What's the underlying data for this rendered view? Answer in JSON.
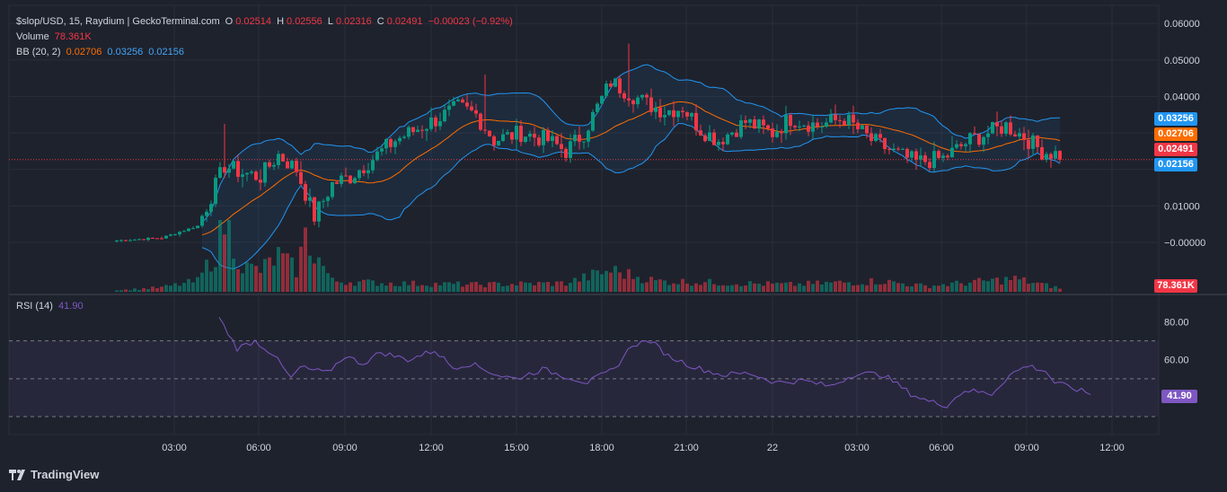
{
  "legend": {
    "symbol": "$slop/USD, 15, Raydium | GeckoTerminal.com",
    "o_label": "O",
    "o_value": "0.02514",
    "h_label": "H",
    "h_value": "0.02556",
    "l_label": "L",
    "l_value": "0.02316",
    "c_label": "C",
    "c_value": "0.02491",
    "change": "−0.00023 (−0.92%)",
    "volume_label": "Volume",
    "volume_value": "78.361K",
    "bb_label": "BB (20, 2)",
    "bb_mid": "0.02706",
    "bb_upper": "0.03256",
    "bb_lower": "0.02156",
    "rsi_label": "RSI (14)",
    "rsi_value": "41.90"
  },
  "price_axis": {
    "ticks": [
      "0.06000",
      "0.05000",
      "0.04000",
      "0.01000",
      "−0.00000"
    ],
    "tags": {
      "upper": "0.03256",
      "mid": "0.02706",
      "close": "0.02491",
      "lower": "0.02156",
      "volume": "78.361K"
    }
  },
  "rsi_axis": {
    "ticks": [
      "80.00",
      "60.00"
    ],
    "tag": "41.90"
  },
  "time_axis": {
    "ticks": [
      "03:00",
      "06:00",
      "09:00",
      "12:00",
      "15:00",
      "18:00",
      "21:00",
      "22",
      "03:00",
      "06:00",
      "09:00",
      "12:00"
    ]
  },
  "footer": {
    "brand": "TradingView"
  },
  "colors": {
    "up": "#089981",
    "down": "#f23645",
    "bb_mid": "#ff6d00",
    "bb_band": "#2196f3",
    "rsi": "#7e57c2",
    "background": "#1e222d",
    "grid": "#2a2e39"
  },
  "chart_data": [
    {
      "type": "candlestick",
      "pair": "$slop/USD",
      "interval": "15",
      "ylim": [
        -0.002,
        0.062
      ],
      "close_anchors": [
        [
          0,
          0.0005
        ],
        [
          10,
          0.0012
        ],
        [
          18,
          0.0045
        ],
        [
          24,
          0.021
        ],
        [
          28,
          0.019
        ],
        [
          32,
          0.018
        ],
        [
          36,
          0.024
        ],
        [
          40,
          0.02
        ],
        [
          44,
          0.007
        ],
        [
          48,
          0.016
        ],
        [
          52,
          0.018
        ],
        [
          56,
          0.022
        ],
        [
          62,
          0.028
        ],
        [
          70,
          0.033
        ],
        [
          76,
          0.037
        ],
        [
          80,
          0.035
        ],
        [
          84,
          0.028
        ],
        [
          90,
          0.03
        ],
        [
          96,
          0.028
        ],
        [
          100,
          0.025
        ],
        [
          104,
          0.03
        ],
        [
          110,
          0.044
        ],
        [
          114,
          0.041
        ],
        [
          118,
          0.038
        ],
        [
          122,
          0.036
        ],
        [
          126,
          0.037
        ],
        [
          130,
          0.031
        ],
        [
          134,
          0.028
        ],
        [
          140,
          0.033
        ],
        [
          146,
          0.03
        ],
        [
          150,
          0.034
        ],
        [
          156,
          0.032
        ],
        [
          162,
          0.034
        ],
        [
          168,
          0.028
        ],
        [
          174,
          0.024
        ],
        [
          178,
          0.022
        ],
        [
          184,
          0.023
        ],
        [
          190,
          0.028
        ],
        [
          194,
          0.03
        ],
        [
          198,
          0.032
        ],
        [
          202,
          0.029
        ],
        [
          206,
          0.025
        ],
        [
          210,
          0.024
        ]
      ]
    },
    {
      "type": "bar",
      "series": [
        {
          "name": "Volume"
        }
      ],
      "latest": "78.361K",
      "relative_anchors": [
        [
          0,
          0.02
        ],
        [
          10,
          0.06
        ],
        [
          18,
          0.15
        ],
        [
          22,
          0.55
        ],
        [
          24,
          1.0
        ],
        [
          28,
          0.35
        ],
        [
          32,
          0.3
        ],
        [
          36,
          0.5
        ],
        [
          40,
          0.3
        ],
        [
          42,
          0.75
        ],
        [
          44,
          0.55
        ],
        [
          48,
          0.15
        ],
        [
          60,
          0.12
        ],
        [
          80,
          0.1
        ],
        [
          100,
          0.12
        ],
        [
          110,
          0.3
        ],
        [
          120,
          0.15
        ],
        [
          150,
          0.1
        ],
        [
          170,
          0.15
        ],
        [
          180,
          0.08
        ],
        [
          200,
          0.18
        ],
        [
          210,
          0.05
        ]
      ]
    },
    {
      "type": "line",
      "series": [
        {
          "name": "RSI (14)"
        }
      ],
      "ylim": [
        30,
        85
      ],
      "y_ticks": [
        80,
        60
      ],
      "bands": [
        70,
        50,
        30
      ],
      "latest": 41.9,
      "anchors": [
        [
          0,
          82
        ],
        [
          4,
          66
        ],
        [
          8,
          70
        ],
        [
          12,
          63
        ],
        [
          16,
          50
        ],
        [
          18,
          56
        ],
        [
          24,
          53
        ],
        [
          28,
          62
        ],
        [
          32,
          58
        ],
        [
          36,
          64
        ],
        [
          42,
          60
        ],
        [
          48,
          65
        ],
        [
          52,
          56
        ],
        [
          56,
          58
        ],
        [
          62,
          52
        ],
        [
          66,
          50
        ],
        [
          72,
          55
        ],
        [
          76,
          52
        ],
        [
          82,
          48
        ],
        [
          88,
          55
        ],
        [
          92,
          68
        ],
        [
          96,
          70
        ],
        [
          100,
          62
        ],
        [
          106,
          56
        ],
        [
          112,
          52
        ],
        [
          118,
          53
        ],
        [
          124,
          48
        ],
        [
          130,
          49
        ],
        [
          136,
          46
        ],
        [
          142,
          53
        ],
        [
          148,
          52
        ],
        [
          154,
          42
        ],
        [
          158,
          38
        ],
        [
          162,
          36
        ],
        [
          166,
          44
        ],
        [
          172,
          42
        ],
        [
          176,
          52
        ],
        [
          180,
          57
        ],
        [
          184,
          54
        ],
        [
          186,
          48
        ],
        [
          190,
          45
        ],
        [
          194,
          42
        ]
      ]
    }
  ]
}
